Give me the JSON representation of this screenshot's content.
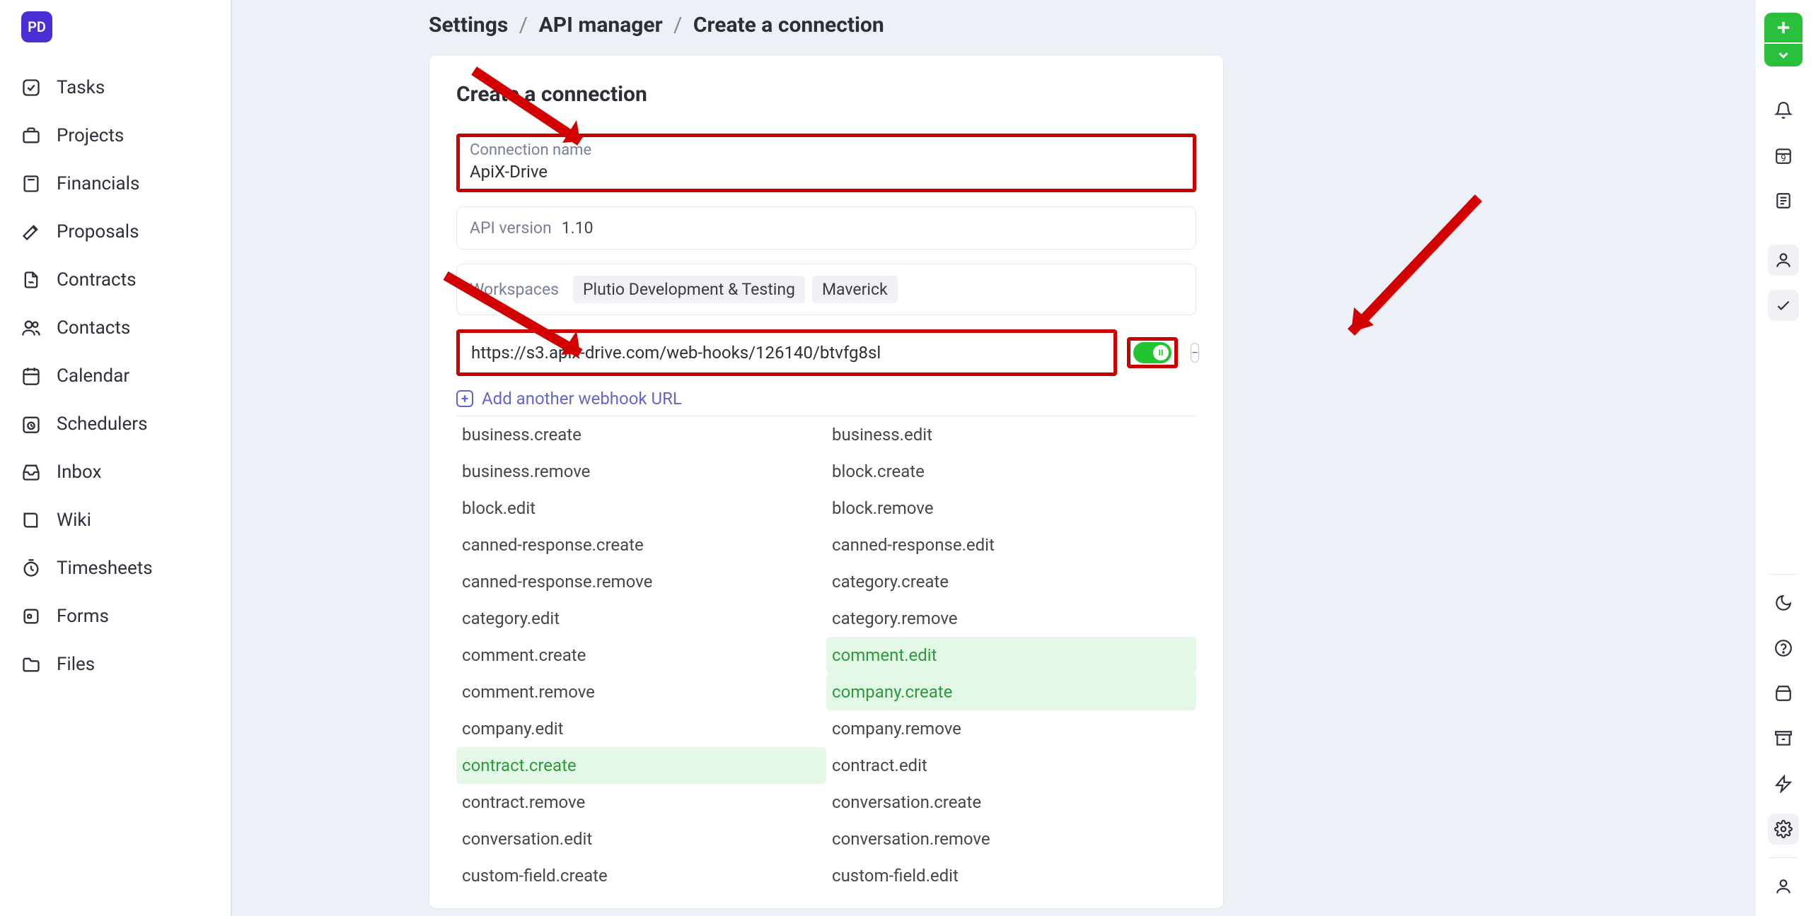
{
  "logo_text": "PD",
  "sidebar": {
    "items": [
      {
        "label": "Tasks",
        "icon": "check-square"
      },
      {
        "label": "Projects",
        "icon": "briefcase"
      },
      {
        "label": "Financials",
        "icon": "calculator"
      },
      {
        "label": "Proposals",
        "icon": "pen"
      },
      {
        "label": "Contracts",
        "icon": "file-sign"
      },
      {
        "label": "Contacts",
        "icon": "users"
      },
      {
        "label": "Calendar",
        "icon": "calendar"
      },
      {
        "label": "Schedulers",
        "icon": "clock-cal"
      },
      {
        "label": "Inbox",
        "icon": "inbox"
      },
      {
        "label": "Wiki",
        "icon": "book"
      },
      {
        "label": "Timesheets",
        "icon": "timer"
      },
      {
        "label": "Forms",
        "icon": "form"
      },
      {
        "label": "Files",
        "icon": "folder"
      }
    ]
  },
  "breadcrumb": {
    "a": "Settings",
    "b": "API manager",
    "c": "Create a connection"
  },
  "form": {
    "heading": "Create a connection",
    "conn_label": "Connection name",
    "conn_value": "ApiX-Drive",
    "api_ver_label": "API version",
    "api_ver_value": "1.10",
    "workspaces_label": "Workspaces",
    "workspaces_chips": [
      "Plutio Development & Testing",
      "Maverick"
    ],
    "webhook_url": "https://s3.apix-drive.com/web-hooks/126140/btvfg8sl",
    "add_webhook": "Add another webhook URL"
  },
  "events": {
    "left": [
      {
        "t": "business.create"
      },
      {
        "t": "business.remove"
      },
      {
        "t": "block.edit"
      },
      {
        "t": "canned-response.create"
      },
      {
        "t": "canned-response.remove"
      },
      {
        "t": "category.edit"
      },
      {
        "t": "comment.create"
      },
      {
        "t": "comment.remove"
      },
      {
        "t": "company.edit"
      },
      {
        "t": "contract.create",
        "s": true
      },
      {
        "t": "contract.remove"
      },
      {
        "t": "conversation.edit"
      },
      {
        "t": "custom-field.create"
      }
    ],
    "right": [
      {
        "t": "business.edit"
      },
      {
        "t": "block.create"
      },
      {
        "t": "block.remove"
      },
      {
        "t": "canned-response.edit"
      },
      {
        "t": "category.create"
      },
      {
        "t": "category.remove"
      },
      {
        "t": "comment.edit",
        "s": true
      },
      {
        "t": "company.create",
        "s": true
      },
      {
        "t": "company.remove"
      },
      {
        "t": "contract.edit"
      },
      {
        "t": "conversation.create"
      },
      {
        "t": "conversation.remove"
      },
      {
        "t": "custom-field.edit"
      }
    ]
  },
  "right_rail": {
    "calendar_day": "9"
  }
}
